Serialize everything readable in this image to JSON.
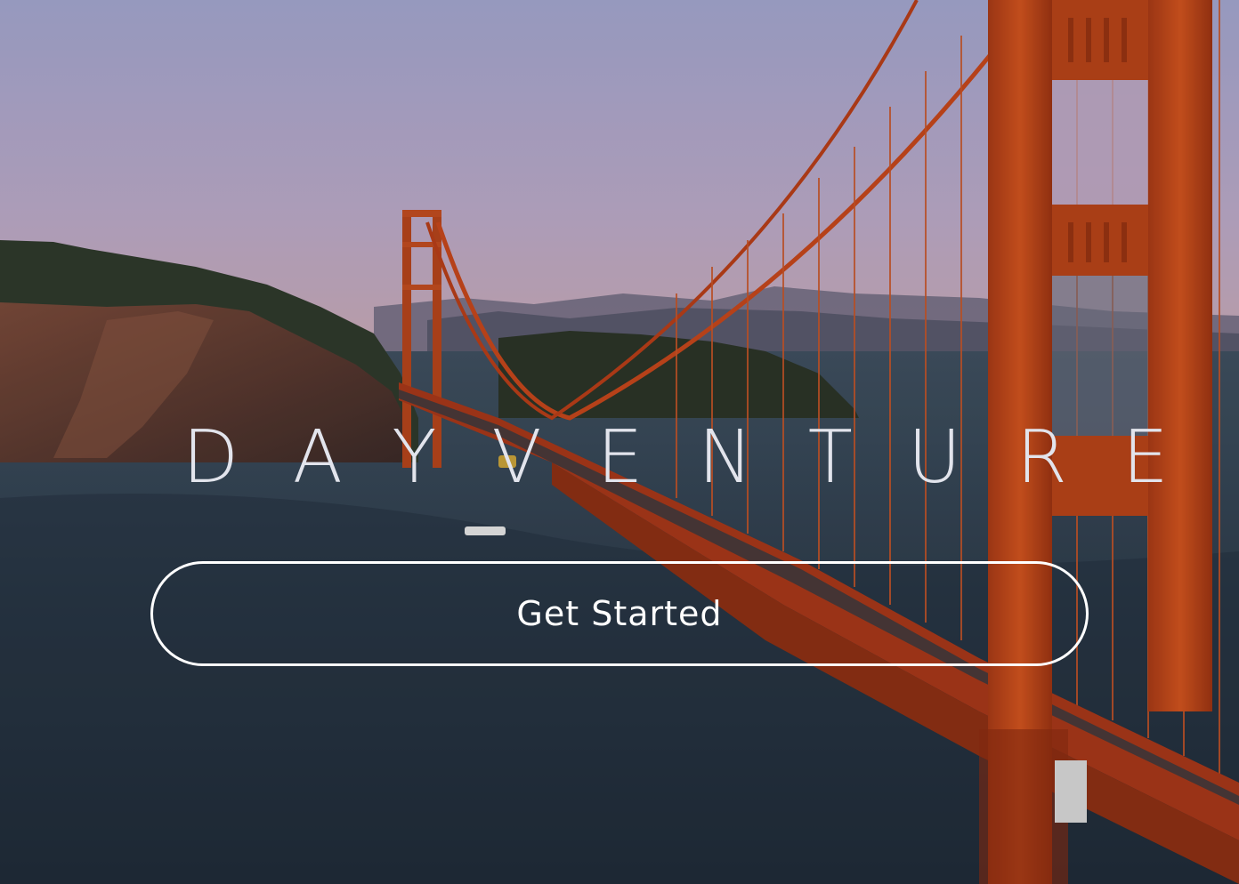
{
  "hero": {
    "brand": "DAYVENTURE",
    "cta_label": "Get Started",
    "background": "golden-gate-bridge-aerial-photo"
  },
  "colors": {
    "bridge": "#c2461c",
    "sky_top": "#a4a7cf",
    "sky_bottom": "#c9a9b5",
    "water": "#2a3846",
    "text": "#ffffff"
  }
}
